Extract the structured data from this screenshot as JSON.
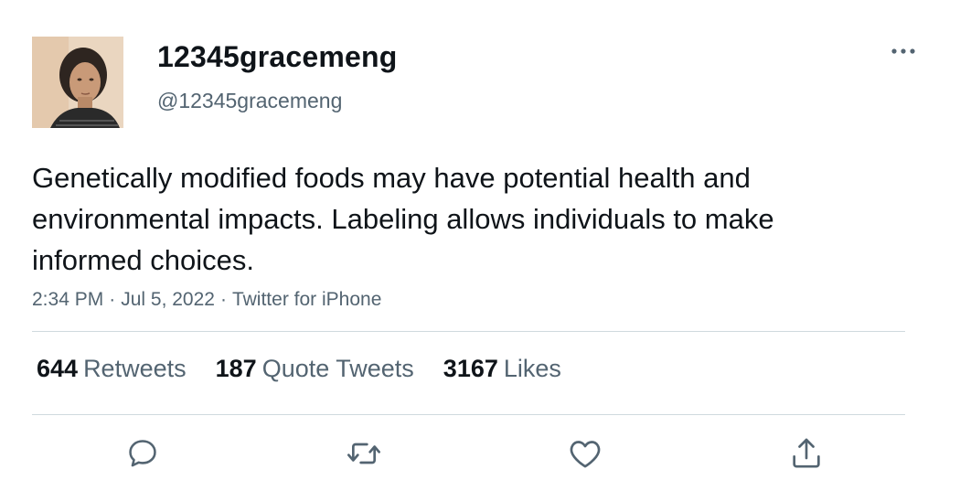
{
  "user": {
    "display_name": "12345gracemeng",
    "handle": "@12345gracemeng",
    "avatar_icon": "profile-photo"
  },
  "tweet": {
    "text": "Genetically modified foods may have potential health and environmental impacts. Labeling allows individuals to make informed choices.",
    "time": "2:34 PM",
    "date": "Jul 5, 2022",
    "source": "Twitter for iPhone",
    "separator": "·"
  },
  "stats": {
    "retweets_count": "644",
    "retweets_label": "Retweets",
    "quotes_count": "187",
    "quotes_label": "Quote Tweets",
    "likes_count": "3167",
    "likes_label": "Likes"
  },
  "actions": {
    "reply_icon": "reply-icon",
    "retweet_icon": "retweet-icon",
    "like_icon": "heart-icon",
    "share_icon": "share-icon",
    "more_icon": "more-icon"
  },
  "colors": {
    "text": "#0f1419",
    "secondary": "#536471",
    "divider": "#cfd9de"
  }
}
